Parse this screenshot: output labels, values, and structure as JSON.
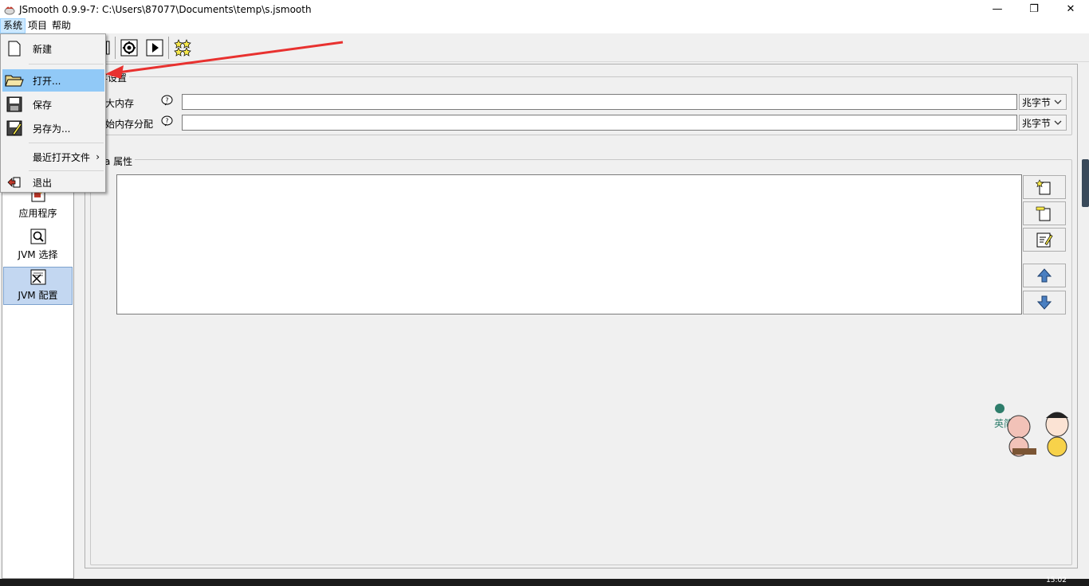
{
  "window": {
    "title": "JSmooth 0.9.9-7: C:\\Users\\87077\\Documents\\temp\\s.jsmooth",
    "minimize": "—",
    "restore": "❐",
    "close": "✕"
  },
  "menubar": {
    "items": [
      {
        "label": "系统"
      },
      {
        "label": "项目"
      },
      {
        "label": "帮助"
      }
    ]
  },
  "dropdown": {
    "items": [
      {
        "label": "新建",
        "icon": "new-file-icon"
      },
      {
        "label": "打开...",
        "icon": "open-folder-icon"
      },
      {
        "label": "保存",
        "icon": "save-icon"
      },
      {
        "label": "另存为...",
        "icon": "save-as-icon"
      },
      {
        "label": "最近打开文件",
        "icon": "",
        "submenu": "›"
      },
      {
        "label": "退出",
        "icon": "exit-icon"
      }
    ]
  },
  "sidebar": {
    "items": [
      {
        "label": "应用程序",
        "icon": "application-icon"
      },
      {
        "label": "JVM 选择",
        "icon": "jvm-select-icon"
      },
      {
        "label": "JVM 配置",
        "icon": "jvm-config-icon",
        "selected": true
      }
    ]
  },
  "main": {
    "memory_group": {
      "title": "存设置",
      "rows": [
        {
          "label": "大内存",
          "value": "",
          "unit": "兆字节"
        },
        {
          "label": "始内存分配",
          "value": "",
          "unit": "兆字节"
        }
      ]
    },
    "props_group": {
      "title": "a 属性"
    }
  },
  "taskbar": {
    "time": "15:02"
  },
  "sticker": {
    "text": "英简"
  },
  "colors": {
    "accent": "#91c9f7",
    "selected": "#c3d7f1",
    "arrow": "#e8312f"
  }
}
